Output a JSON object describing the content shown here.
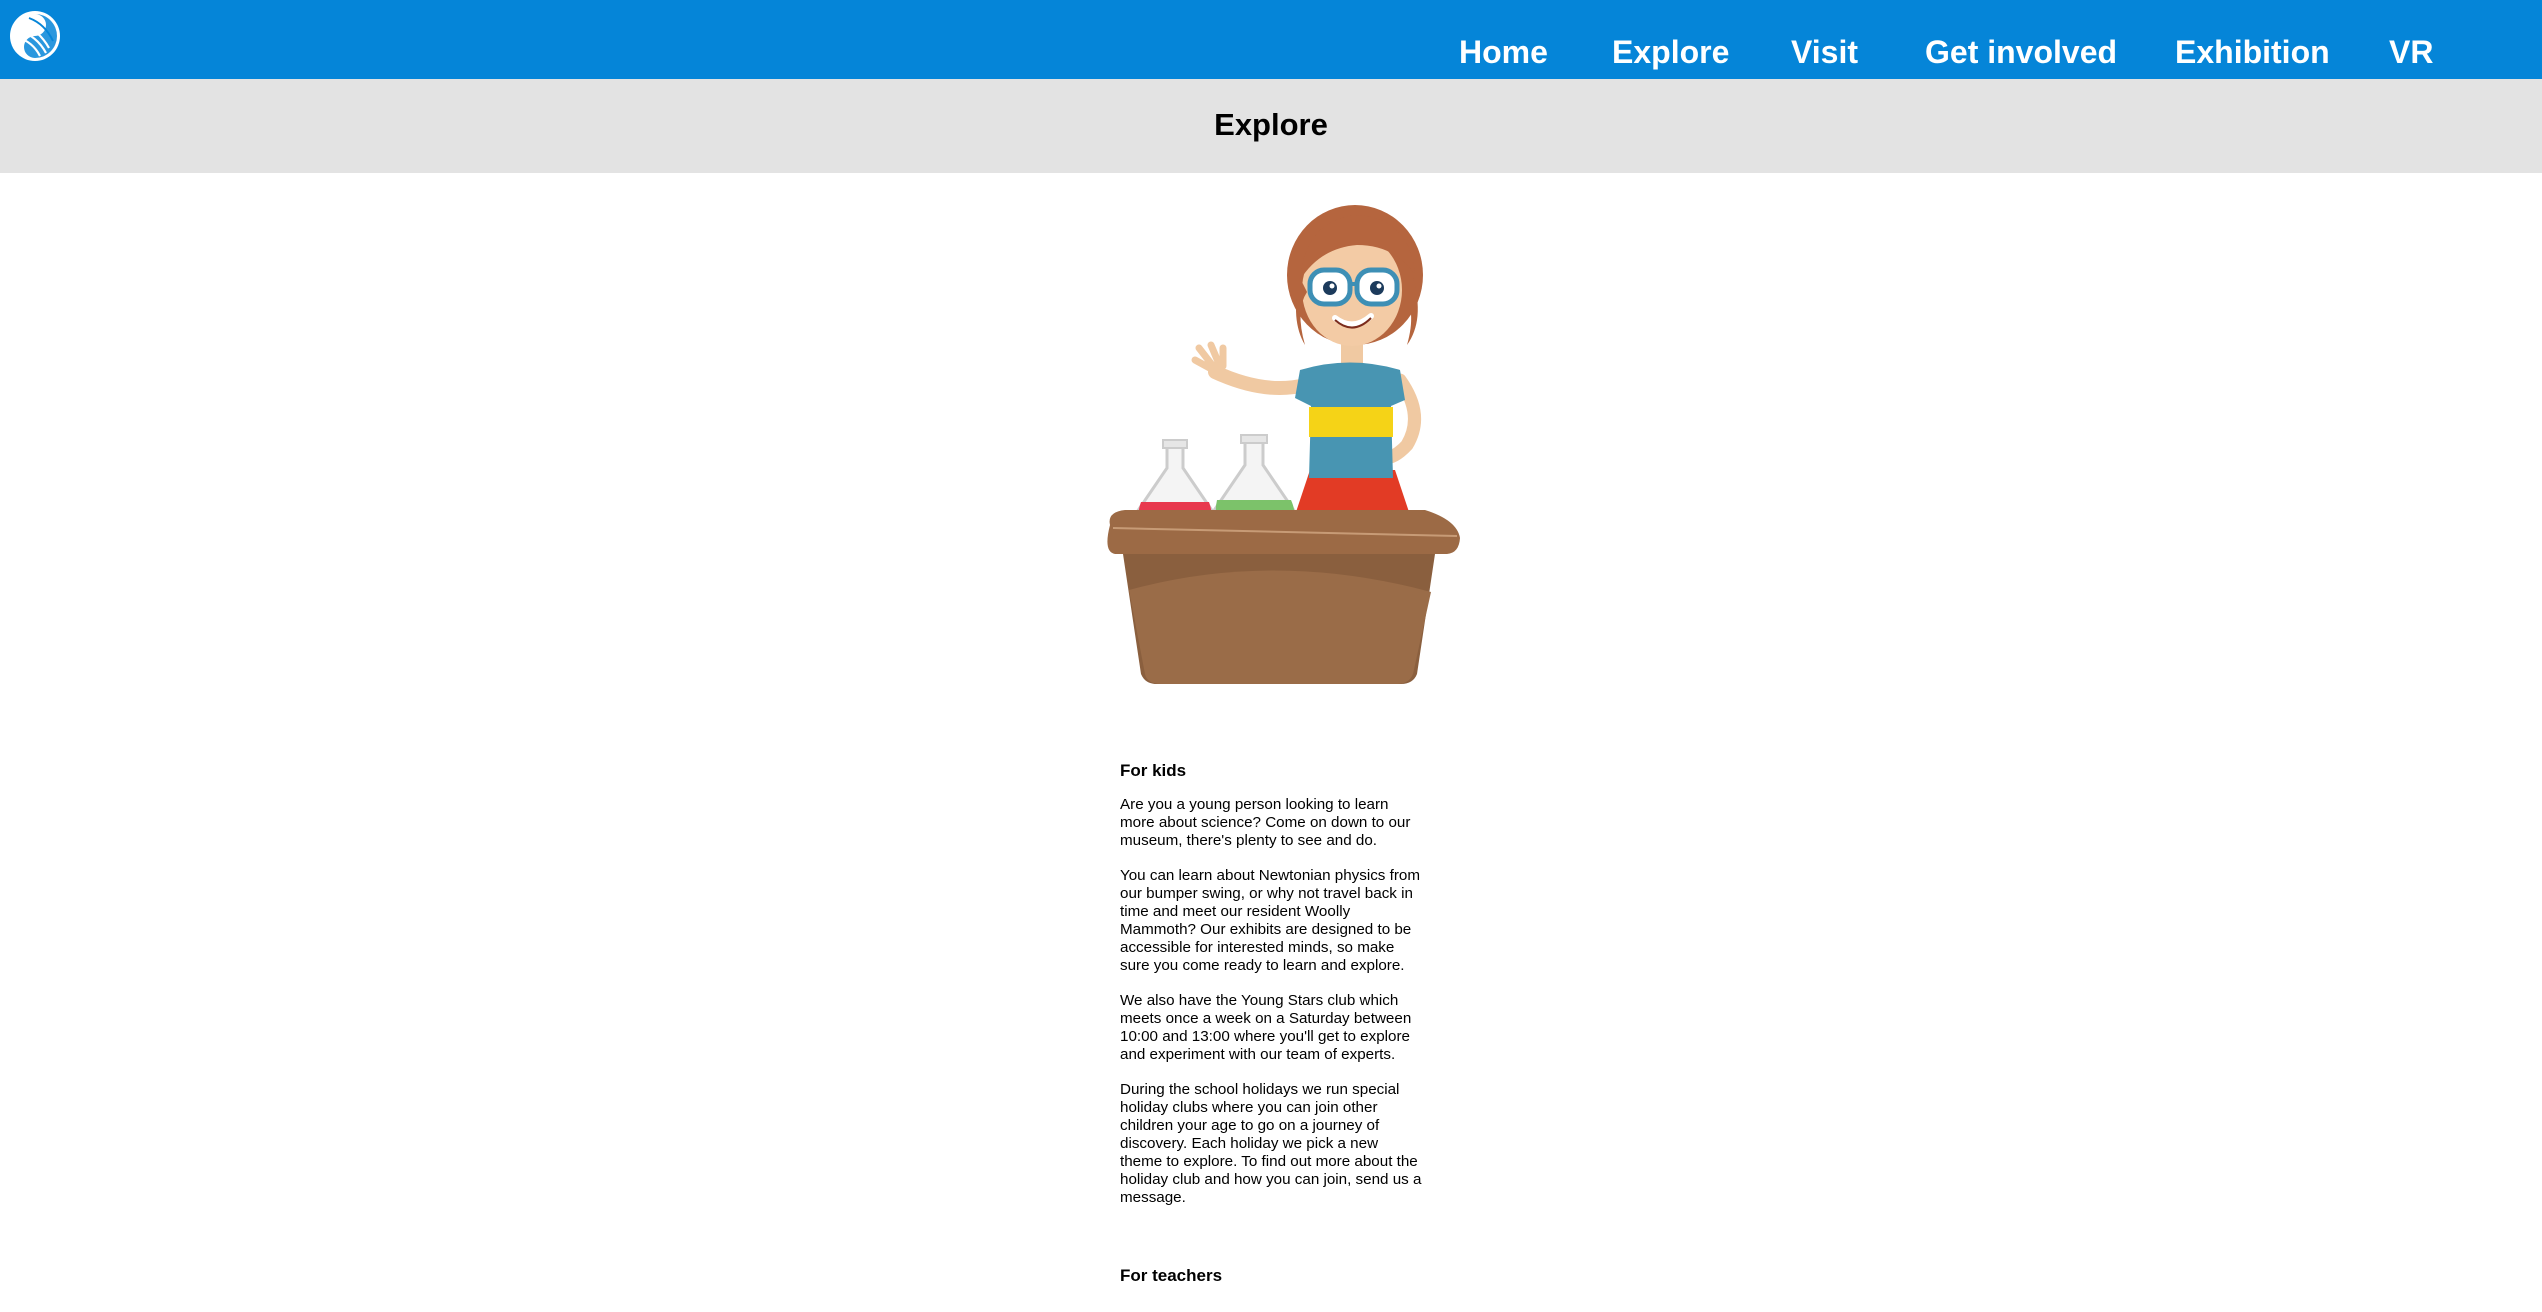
{
  "header": {
    "logo": "swirl-logo-icon",
    "nav": [
      "Home",
      "Explore",
      "Visit",
      "Get involved",
      "Exhibition",
      "VR"
    ],
    "background_color": "#0585d8"
  },
  "banner": {
    "title": "Explore",
    "background_color": "#e3e3e3"
  },
  "illustration": {
    "name": "scientist-girl-illustration"
  },
  "sections": [
    {
      "heading": "For kids",
      "paragraphs": [
        "Are you a young person looking to learn more about science? Come on down to our museum, there's plenty to see and do.",
        "You can learn about Newtonian physics from our bumper swing, or why not travel back in time and meet our resident Woolly Mammoth? Our exhibits are designed to be accessible for interested minds, so make sure you come ready to learn and explore.",
        "We also have the Young Stars club which meets once a week on a Saturday between 10:00 and 13:00 where you'll get to explore and experiment with our team of experts.",
        "During the school holidays we run special holiday clubs where you can join other children your age to go on a journey of discovery. Each holiday we pick a new theme to explore. To find out more about the holiday club and how you can join, send us a message."
      ]
    },
    {
      "heading": "For teachers"
    }
  ]
}
